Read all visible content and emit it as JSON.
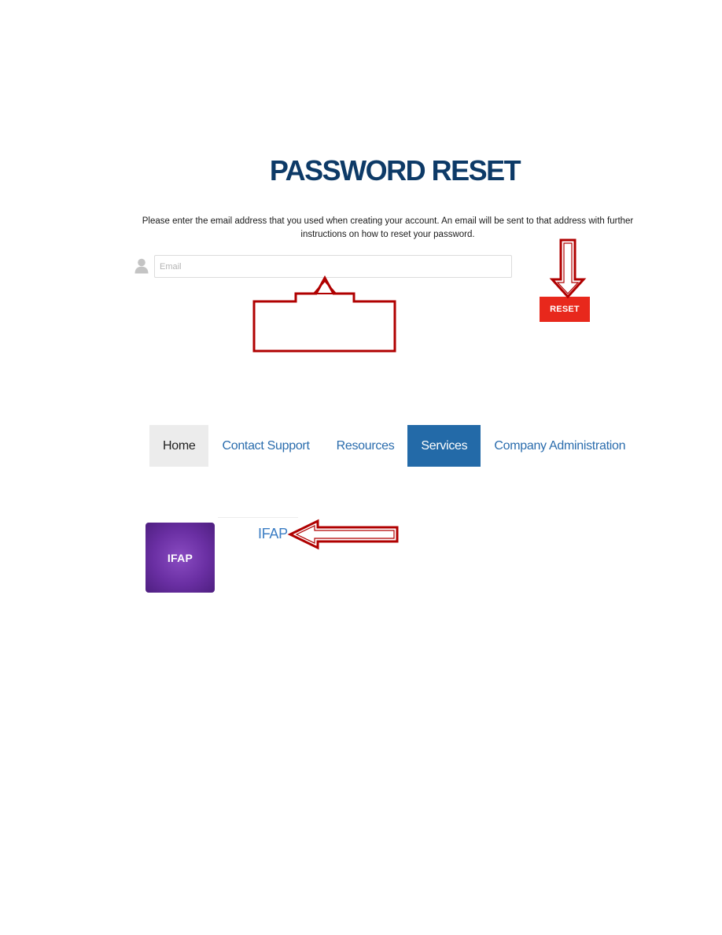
{
  "page": {
    "title": "PASSWORD RESET",
    "instructions": "Please enter the email address that you used when creating your account. An email will be sent to that address with further instructions on how to reset your password."
  },
  "form": {
    "email_placeholder": "Email",
    "email_value": "",
    "reset_label": "RESET",
    "user_icon": "user-icon"
  },
  "nav": {
    "items": [
      {
        "label": "Home",
        "state": "hover"
      },
      {
        "label": "Contact Support",
        "state": "default"
      },
      {
        "label": "Resources",
        "state": "default"
      },
      {
        "label": "Services",
        "state": "active"
      },
      {
        "label": "Company Administration",
        "state": "default"
      }
    ]
  },
  "services": {
    "tile_label": "IFAP",
    "link_label": "IFAP"
  },
  "colors": {
    "title": "#0d3a67",
    "reset_button": "#e8281c",
    "nav_link": "#2a6cad",
    "nav_active_bg": "#236aa8",
    "nav_hover_bg": "#ececec",
    "tile": "#6a2fa3",
    "annotation_arrow": "#b00000"
  },
  "annotations": [
    "up-arrow-callout",
    "down-arrow",
    "left-arrow"
  ]
}
